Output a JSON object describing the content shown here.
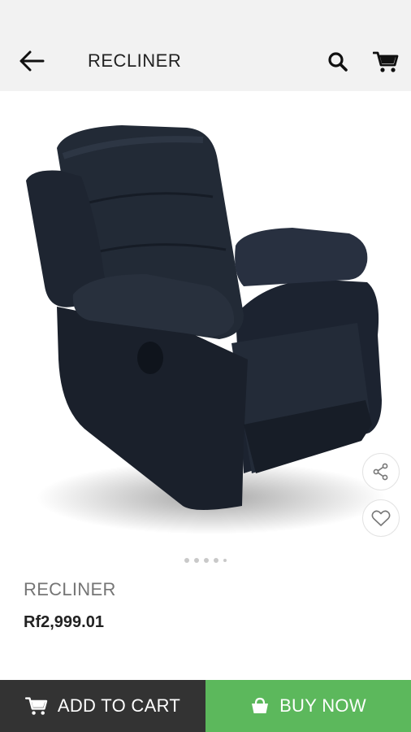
{
  "app_bar": {
    "title": "RECLINER",
    "icons": [
      "back-arrow-icon",
      "search-icon",
      "cart-icon"
    ]
  },
  "product": {
    "image_alt": "Recliner",
    "name": "RECLINER",
    "price": "Rf2,999.01",
    "image_count": 5,
    "active_image": 0
  },
  "actions": {
    "share_icon": "share-icon",
    "favorite_icon": "heart-icon"
  },
  "bottom_bar": {
    "add_to_cart_label": "ADD TO CART",
    "buy_now_label": "BUY NOW"
  },
  "colors": {
    "app_bar_bg": "#f2f2f2",
    "add_to_cart_bg": "#333333",
    "buy_now_bg": "#5cb85c",
    "product_color": "#1f2630"
  }
}
